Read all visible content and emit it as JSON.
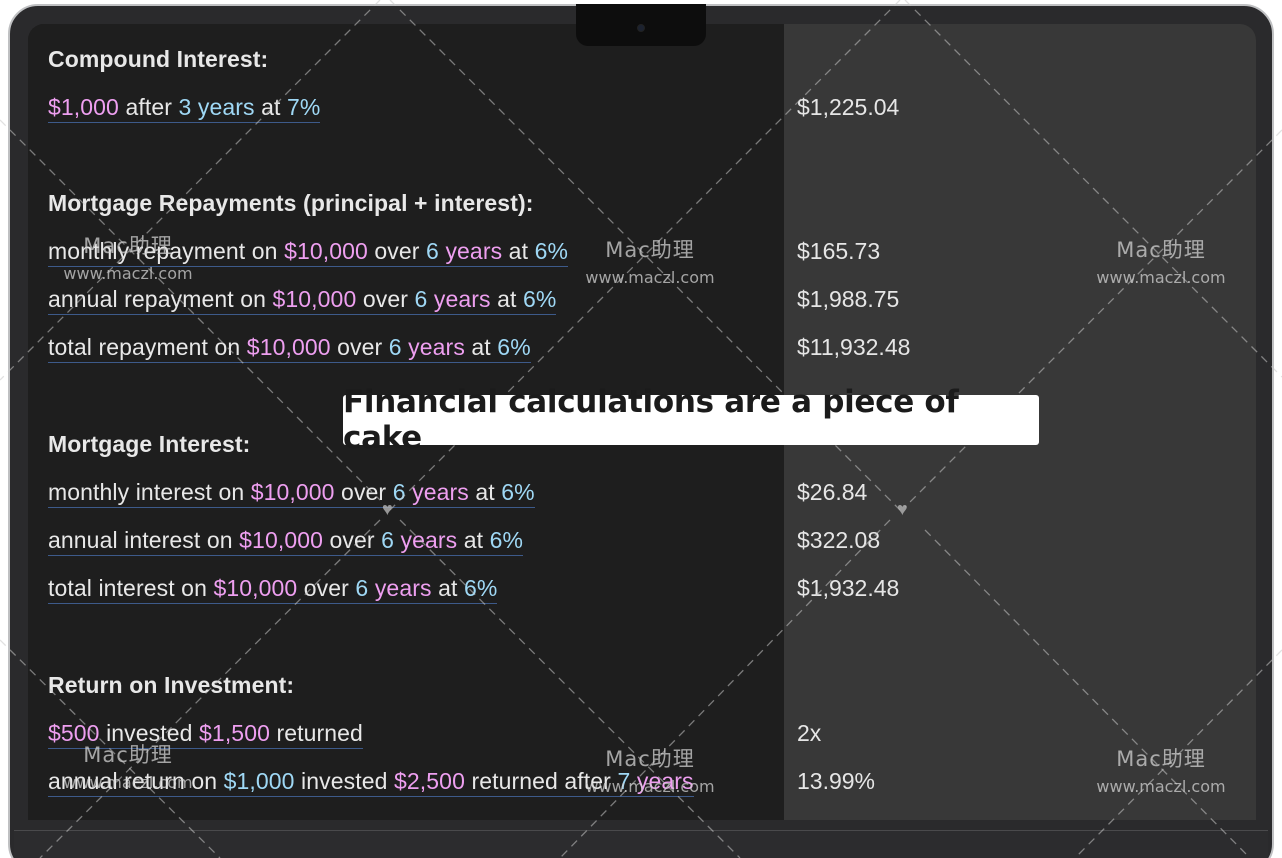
{
  "caption": "Financial calculations are a piece of cake",
  "watermark": {
    "title": "Mac助理",
    "url": "www.maczl.com"
  },
  "sections": {
    "compound": {
      "heading": "Compound Interest:",
      "row1": {
        "a": "$1,000",
        "b": " after ",
        "c": "3",
        "d": " ",
        "e": "years",
        "f": " at ",
        "g": "7%",
        "result": "$1,225.04"
      }
    },
    "repay": {
      "heading": "Mortgage Repayments (principal + interest):",
      "row1": {
        "prefix": "monthly repayment on ",
        "amount": "$10,000",
        "over": " over ",
        "n": "6",
        "years": "years",
        "at": " at ",
        "rate": "6%",
        "result": "$165.73"
      },
      "row2": {
        "prefix": "annual repayment on ",
        "amount": "$10,000",
        "over": " over ",
        "n": "6",
        "years": "years",
        "at": " at ",
        "rate": "6%",
        "result": "$1,988.75"
      },
      "row3": {
        "prefix": "total repayment on ",
        "amount": "$10,000",
        "over": " over ",
        "n": "6",
        "years": "years",
        "at": " at ",
        "rate": "6%",
        "result": "$11,932.48"
      }
    },
    "interest": {
      "heading": "Mortgage Interest:",
      "row1": {
        "prefix": "monthly interest on ",
        "amount": "$10,000",
        "over": " over ",
        "n": "6",
        "years": "years",
        "at": " at ",
        "rate": "6%",
        "result": "$26.84"
      },
      "row2": {
        "prefix": "annual interest on ",
        "amount": "$10,000",
        "over": " over ",
        "n": "6",
        "years": "years",
        "at": " at ",
        "rate": "6%",
        "result": "$322.08"
      },
      "row3": {
        "prefix": "total interest on ",
        "amount": "$10,000",
        "over": " over ",
        "n": "6",
        "years": "years",
        "at": " at ",
        "rate": "6%",
        "result": "$1,932.48"
      }
    },
    "roi": {
      "heading": "Return on Investment:",
      "row1": {
        "a": "$500",
        "b": " invested ",
        "c": "$1,500",
        "d": " returned",
        "result": "2x"
      },
      "row2": {
        "a": "annual return on ",
        "b": "$1,000",
        "c": " invested ",
        "d": "$2,500",
        "e": " returned after ",
        "f": "7",
        "g": " ",
        "h": "years",
        "result": "13.99%"
      }
    }
  },
  "colors": {
    "number": "#9fd8f5",
    "unit": "#ee9ff0",
    "left_bg": "#1e1e1e",
    "right_bg": "#383838"
  }
}
